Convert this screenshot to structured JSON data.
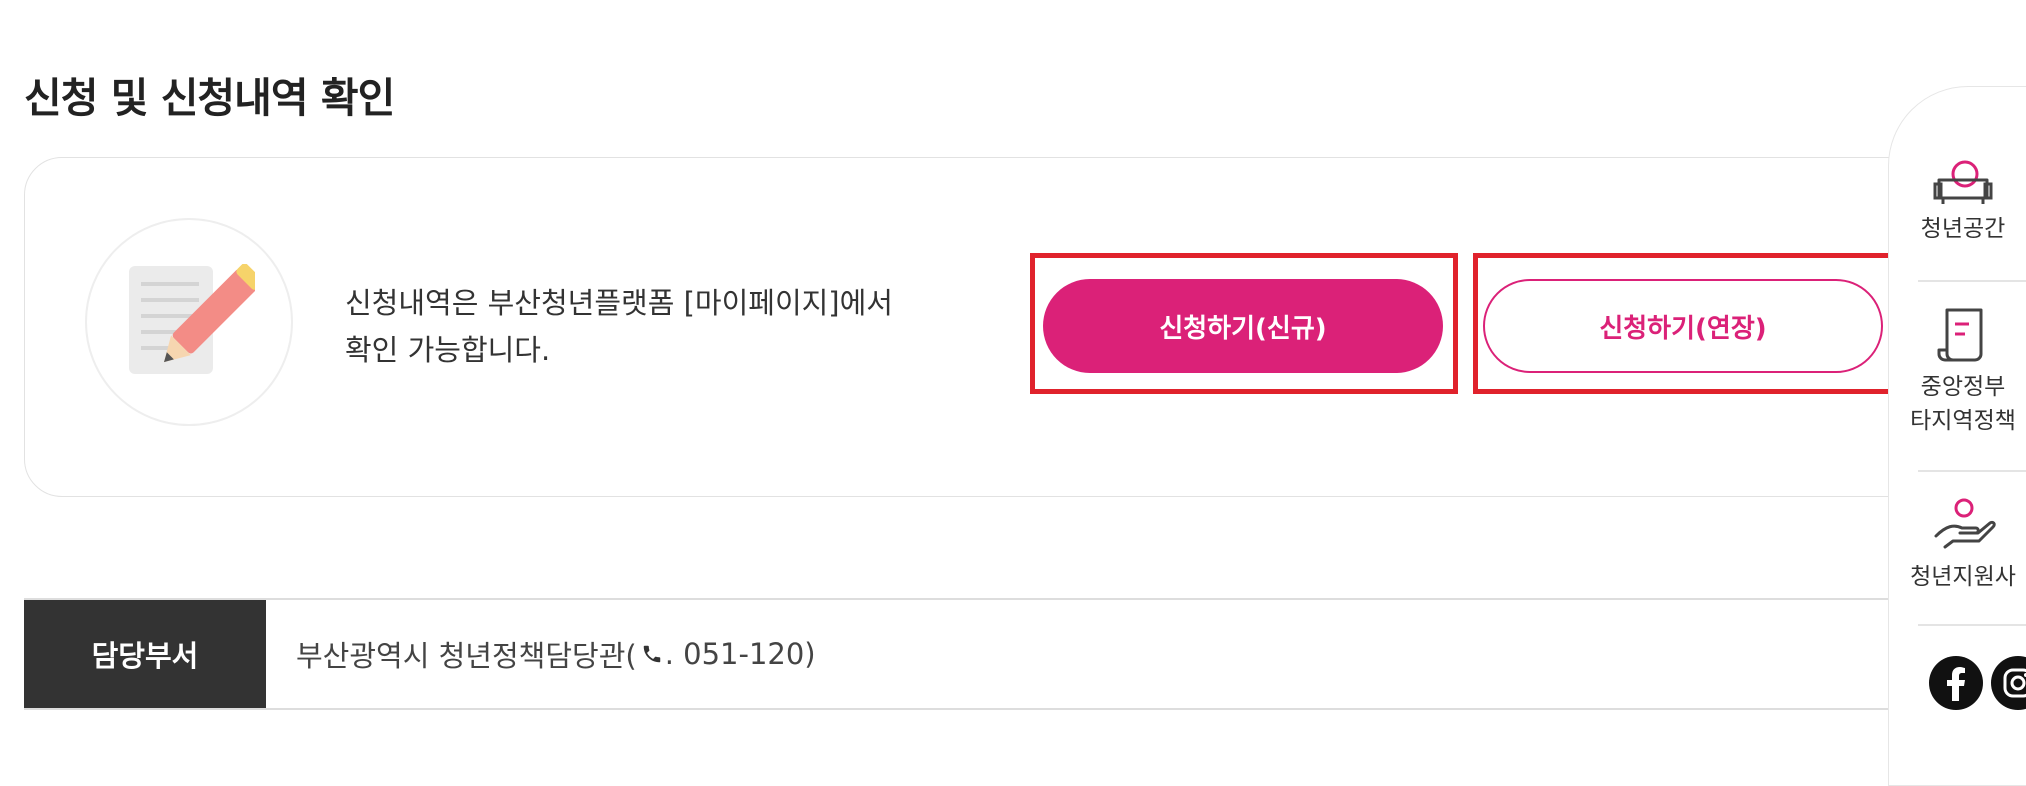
{
  "section": {
    "title": "신청 및 신청내역 확인"
  },
  "card": {
    "icon": "document-pencil-icon",
    "text_line1": "신청내역은 부산청년플랫폼 [마이페이지]에서",
    "text_line2": "확인 가능합니다.",
    "btn_new": "신청하기(신규)",
    "btn_extend": "신청하기(연장)"
  },
  "department": {
    "label": "담당부서",
    "value_prefix": "부산광역시 청년정책담당관(",
    "phone_icon": "phone-icon",
    "value_suffix": ". 051-120)"
  },
  "quick_menu": {
    "item1": {
      "icon": "sofa-icon",
      "label": "청년공간"
    },
    "item2": {
      "icon": "document-scroll-icon",
      "line1": "중앙정부",
      "line2": "타지역정책"
    },
    "item3": {
      "icon": "hand-person-icon",
      "label": "청년지원사"
    },
    "sns": [
      "facebook-icon",
      "instagram-icon"
    ]
  },
  "colors": {
    "accent": "#db2178",
    "highlight": "#e0222c",
    "dark": "#333333"
  }
}
